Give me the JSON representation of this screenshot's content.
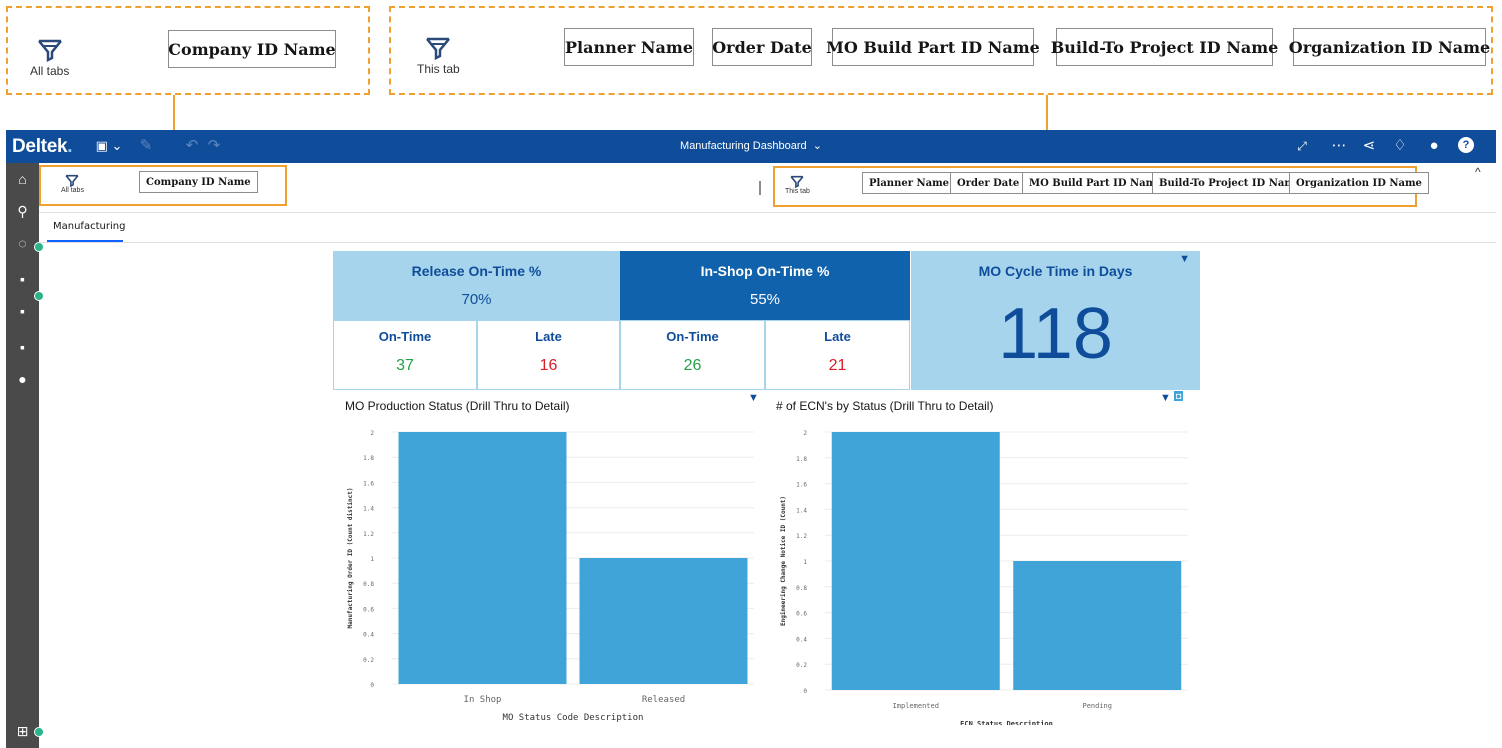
{
  "callouts": {
    "all_tabs": {
      "label": "All tabs",
      "filters": [
        "Company ID Name"
      ]
    },
    "this_tab": {
      "label": "This tab",
      "filters": [
        "Planner Name",
        "Order Date",
        "MO Build Part ID Name",
        "Build-To Project ID Name",
        "Organization ID Name"
      ]
    }
  },
  "app": {
    "logo": "Deltek",
    "logo_dot": ".",
    "dashboard_title": "Manufacturing Dashboard",
    "dashboard_title_chevron": "⌄"
  },
  "filterbar": {
    "all_tabs_label": "All tabs",
    "all_tabs_filters": [
      "Company ID Name"
    ],
    "this_tab_label": "This tab",
    "this_tab_filters": [
      "Planner Name",
      "Order Date",
      "MO Build Part ID Name",
      "Build-To Project ID Name",
      "Organization ID Name"
    ],
    "collapse": "^"
  },
  "tabs": [
    {
      "label": "Manufacturing",
      "active": true
    }
  ],
  "kpis": {
    "release": {
      "title": "Release On-Time %",
      "value": "70%",
      "on_time_label": "On-Time",
      "on_time": "37",
      "late_label": "Late",
      "late": "16"
    },
    "inshop": {
      "title": "In-Shop On-Time %",
      "value": "55%",
      "on_time_label": "On-Time",
      "on_time": "26",
      "late_label": "Late",
      "late": "21"
    },
    "cycle": {
      "title": "MO Cycle Time in Days",
      "value": "118"
    }
  },
  "colors": {
    "brand_blue": "#0f4d9a",
    "light_blue": "#a6d4ec",
    "bar_blue": "#41a4d9",
    "green": "#24a148",
    "red": "#da1e28",
    "callout_orange": "#f0a030"
  },
  "icons": [
    "filter-icon",
    "save-icon",
    "edit-icon",
    "undo-icon",
    "redo-icon",
    "expand-icon",
    "more-icon",
    "share-icon",
    "bell-icon",
    "user-icon",
    "help-icon",
    "home-icon",
    "search-icon",
    "chat-icon",
    "folder-icon",
    "team-folder-icon",
    "starred-folder-icon",
    "recent-icon",
    "add-icon"
  ],
  "chart_data": [
    {
      "type": "bar",
      "title": "MO Production Status (Drill Thru to Detail)",
      "categories": [
        "In Shop",
        "Released"
      ],
      "values": [
        2,
        1
      ],
      "xlabel": "MO Status Code Description",
      "ylabel": "Manufacturing Order ID (Count distinct)",
      "ylim": [
        0,
        2
      ],
      "yticks": [
        "2",
        "1.8",
        "1.6",
        "1.4",
        "1.2",
        "1",
        "0.8",
        "0.6",
        "0.4",
        "0.2",
        "0"
      ],
      "grid": true
    },
    {
      "type": "bar",
      "title": "# of ECN's by Status (Drill Thru to Detail)",
      "categories": [
        "Implemented",
        "Pending"
      ],
      "values": [
        2,
        1
      ],
      "xlabel": "ECN Status Description",
      "ylabel": "Engineering Change Notice ID (Count)",
      "ylim": [
        0,
        2
      ],
      "yticks": [
        "2",
        "1.8",
        "1.6",
        "1.4",
        "1.2",
        "1",
        "0.8",
        "0.6",
        "0.4",
        "0.2",
        "0"
      ],
      "grid": true
    }
  ]
}
